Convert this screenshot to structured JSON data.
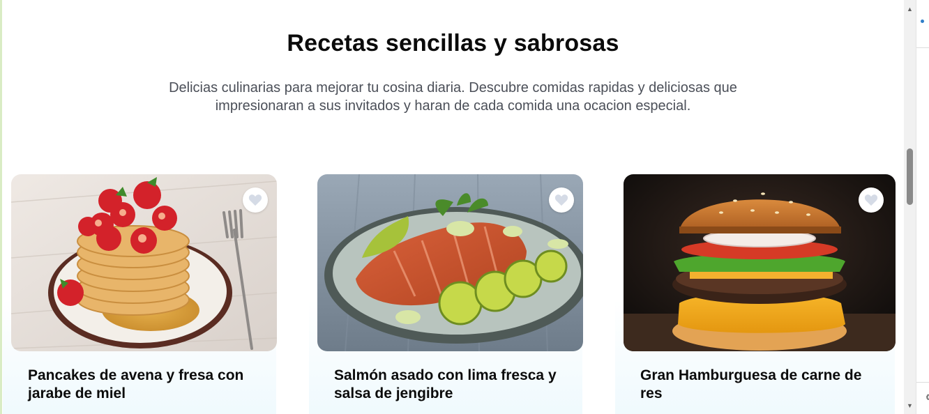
{
  "header": {
    "title": "Recetas sencillas y sabrosas",
    "subtitle": "Delicias culinarias para mejorar tu cosina diaria. Descubre comidas rapidas y deliciosas que impresionaran a sus invitados y haran de cada comida una ocacion especial."
  },
  "recipes": [
    {
      "name": "Pancakes de avena y fresa con jarabe de miel",
      "image": "pancakes-strawberries-photo",
      "favorite_icon": "heart-icon"
    },
    {
      "name": "Salmón asado con lima fresca y salsa de jengibre",
      "image": "grilled-salmon-lime-photo",
      "favorite_icon": "heart-icon"
    },
    {
      "name": "Gran Hamburguesa de carne de res",
      "image": "beef-burger-photo",
      "favorite_icon": "heart-icon"
    }
  ],
  "colors": {
    "title": "#0a0a0a",
    "subtitle": "#4b4f58",
    "card_gradient_bottom": "#eef9fd",
    "heart_icon": "#d5dbe6"
  }
}
